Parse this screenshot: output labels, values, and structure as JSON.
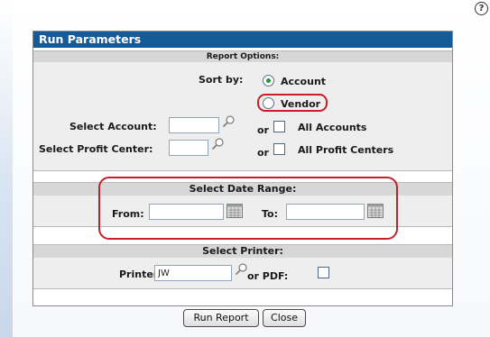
{
  "help_icon": {
    "glyph": "?"
  },
  "panel": {
    "title": "Run Parameters"
  },
  "report_options": {
    "header": "Report Options:",
    "sort_by_label": "Sort by:",
    "sort_options": [
      {
        "label": "Account",
        "selected": true
      },
      {
        "label": "Vendor",
        "selected": false
      }
    ],
    "select_account_label": "Select Account:",
    "select_account_value": "",
    "or_label": "or",
    "all_accounts_label": "All Accounts",
    "select_profit_center_label": "Select Profit Center:",
    "select_profit_center_value": "",
    "all_profit_centers_label": "All Profit Centers"
  },
  "date_range": {
    "header": "Select Date Range:",
    "from_label": "From:",
    "from_value": "",
    "to_label": "To:",
    "to_value": ""
  },
  "printer": {
    "header": "Select Printer:",
    "printer_label": "Printer:",
    "printer_value": "JW",
    "or_pdf_label": "or PDF:",
    "pdf_checked": false
  },
  "buttons": {
    "run_report": "Run Report",
    "close": "Close"
  },
  "colors": {
    "title_bar": "#155b9a",
    "highlight": "#c61e2b",
    "radio_selected": "#1f9a2e"
  }
}
